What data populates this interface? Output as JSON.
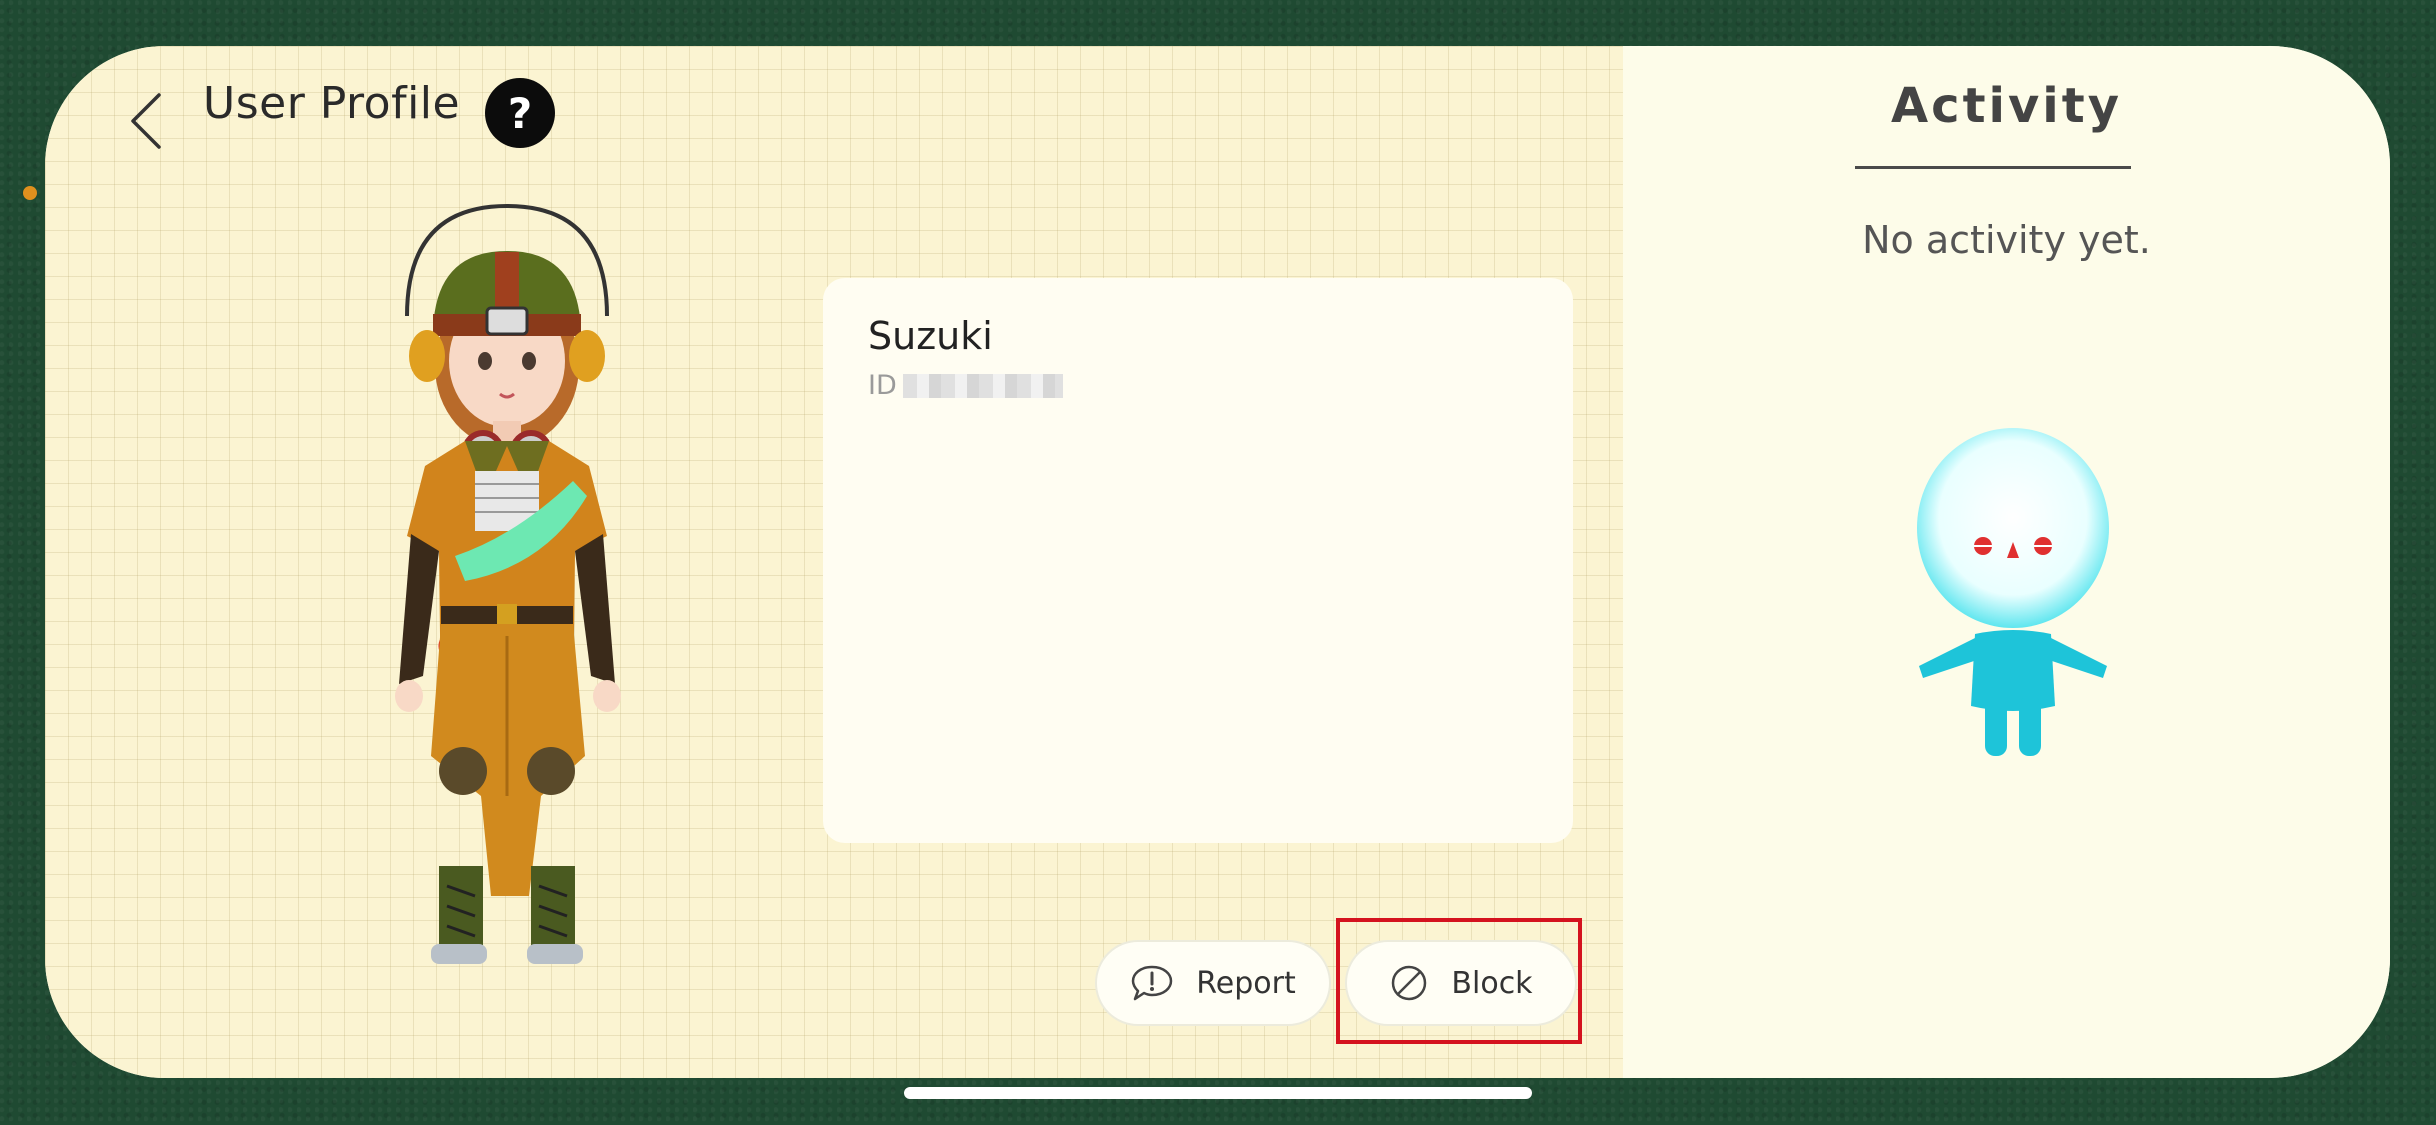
{
  "header": {
    "back_icon": "chevron-left-icon",
    "title": "User Profile",
    "help_label": "?"
  },
  "profile": {
    "name": "Suzuki",
    "id_label": "ID"
  },
  "actions": {
    "report_label": "Report",
    "report_icon": "speech-bubble-exclamation-icon",
    "block_label": "Block",
    "block_icon": "block-circle-icon"
  },
  "activity": {
    "title": "Activity",
    "empty_text": "No activity yet."
  },
  "colors": {
    "highlight": "#d4121e",
    "grid_background": "#fbf4d2",
    "panel_background": "#fdfce9",
    "mascot": "#1ec4d9"
  }
}
